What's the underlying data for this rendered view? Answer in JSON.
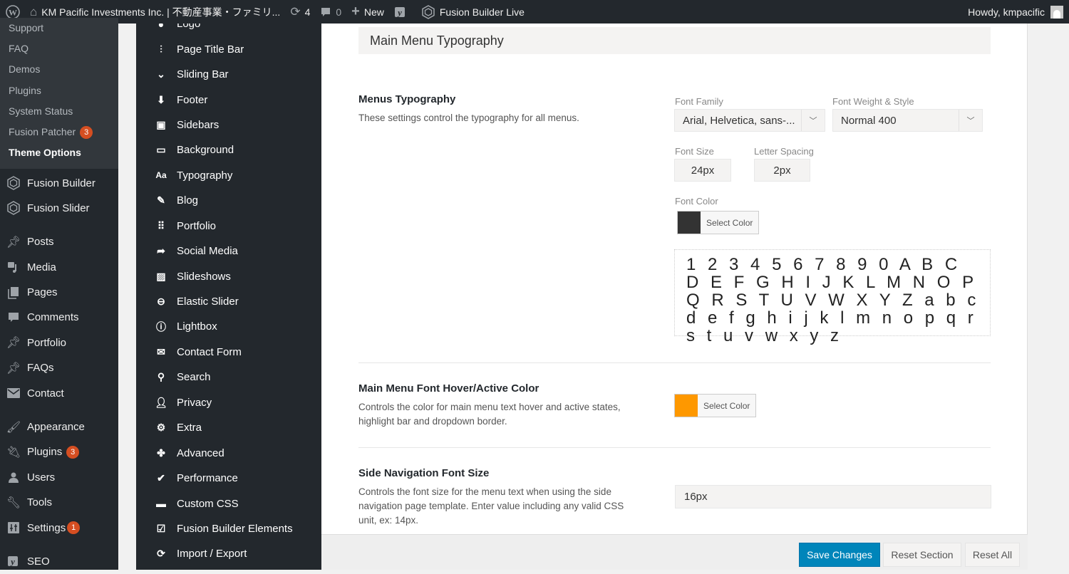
{
  "adminbar": {
    "site_title": "KM Pacific Investments Inc. | 不動産事業・ファミリ...",
    "updates_count": "4",
    "comments_count": "0",
    "new_label": "New",
    "fusion_builder_live": "Fusion Builder Live",
    "howdy": "Howdy, kmpacific"
  },
  "wp_menu": {
    "submenu": [
      {
        "label": "Support"
      },
      {
        "label": "FAQ"
      },
      {
        "label": "Demos"
      },
      {
        "label": "Plugins"
      },
      {
        "label": "System Status"
      },
      {
        "label": "Fusion Patcher",
        "badge": "3"
      },
      {
        "label": "Theme Options",
        "current": true
      }
    ],
    "items": [
      {
        "label": "Fusion Builder",
        "icon": "fusion-icon"
      },
      {
        "label": "Fusion Slider",
        "icon": "fusion-icon"
      },
      {
        "label": "Posts",
        "icon": "pin-icon"
      },
      {
        "label": "Media",
        "icon": "media-icon"
      },
      {
        "label": "Pages",
        "icon": "pages-icon"
      },
      {
        "label": "Comments",
        "icon": "comment-icon"
      },
      {
        "label": "Portfolio",
        "icon": "pin-icon"
      },
      {
        "label": "FAQs",
        "icon": "pin-icon"
      },
      {
        "label": "Contact",
        "icon": "mail-icon"
      },
      {
        "label": "Appearance",
        "icon": "brush-icon"
      },
      {
        "label": "Plugins",
        "icon": "plug-icon",
        "badge": "3"
      },
      {
        "label": "Users",
        "icon": "user-icon"
      },
      {
        "label": "Tools",
        "icon": "wrench-icon"
      },
      {
        "label": "Settings",
        "icon": "settings-icon",
        "badge": "1"
      },
      {
        "label": "SEO",
        "icon": "yoast-icon"
      }
    ]
  },
  "theme_options_nav": [
    {
      "label": "Logo",
      "icon": "logo-icon"
    },
    {
      "label": "Page Title Bar",
      "icon": "sliders-icon"
    },
    {
      "label": "Sliding Bar",
      "icon": "chevron-down-icon"
    },
    {
      "label": "Footer",
      "icon": "arrow-down-icon"
    },
    {
      "label": "Sidebars",
      "icon": "sidebar-icon"
    },
    {
      "label": "Background",
      "icon": "monitor-icon"
    },
    {
      "label": "Typography",
      "icon": "typography-icon"
    },
    {
      "label": "Blog",
      "icon": "edit-icon"
    },
    {
      "label": "Portfolio",
      "icon": "grid-icon"
    },
    {
      "label": "Social Media",
      "icon": "share-icon"
    },
    {
      "label": "Slideshows",
      "icon": "image-icon"
    },
    {
      "label": "Elastic Slider",
      "icon": "slider-icon"
    },
    {
      "label": "Lightbox",
      "icon": "info-icon"
    },
    {
      "label": "Contact Form",
      "icon": "envelope-icon"
    },
    {
      "label": "Search",
      "icon": "search-icon"
    },
    {
      "label": "Privacy",
      "icon": "user-icon"
    },
    {
      "label": "Extra",
      "icon": "gears-icon"
    },
    {
      "label": "Advanced",
      "icon": "puzzle-icon"
    },
    {
      "label": "Performance",
      "icon": "check-circle-icon"
    },
    {
      "label": "Custom CSS",
      "icon": "css-icon"
    },
    {
      "label": "Fusion Builder Elements",
      "icon": "checkbox-icon"
    },
    {
      "label": "Import / Export",
      "icon": "refresh-icon"
    }
  ],
  "section": {
    "title": "Main Menu Typography",
    "menus_typography": {
      "title": "Menus Typography",
      "description": "These settings control the typography for all menus.",
      "font_family_label": "Font Family",
      "font_family_value": "Arial, Helvetica, sans-...",
      "font_weight_label": "Font Weight & Style",
      "font_weight_value": "Normal 400",
      "font_size_label": "Font Size",
      "font_size_value": "24px",
      "letter_spacing_label": "Letter Spacing",
      "letter_spacing_value": "2px",
      "font_color_label": "Font Color",
      "font_color": "#333333",
      "select_color_label": "Select Color",
      "preview_text": "1 2 3 4 5 6 7 8 9 0 A B C D E F G H I J K L M N O P Q R S T U V W X Y Z a b c d e f g h i j k l m n o p q r s t u v w x y z"
    },
    "hover_color": {
      "title": "Main Menu Font Hover/Active Color",
      "description": "Controls the color for main menu text hover and active states, highlight bar and dropdown border.",
      "color": "#fe9800",
      "select_color_label": "Select Color"
    },
    "side_nav_font_size": {
      "title": "Side Navigation Font Size",
      "description": "Controls the font size for the menu text when using the side navigation page template. Enter value including any valid CSS unit, ex: 14px.",
      "value": "16px"
    }
  },
  "footer": {
    "save_label": "Save Changes",
    "reset_section_label": "Reset Section",
    "reset_all_label": "Reset All"
  }
}
